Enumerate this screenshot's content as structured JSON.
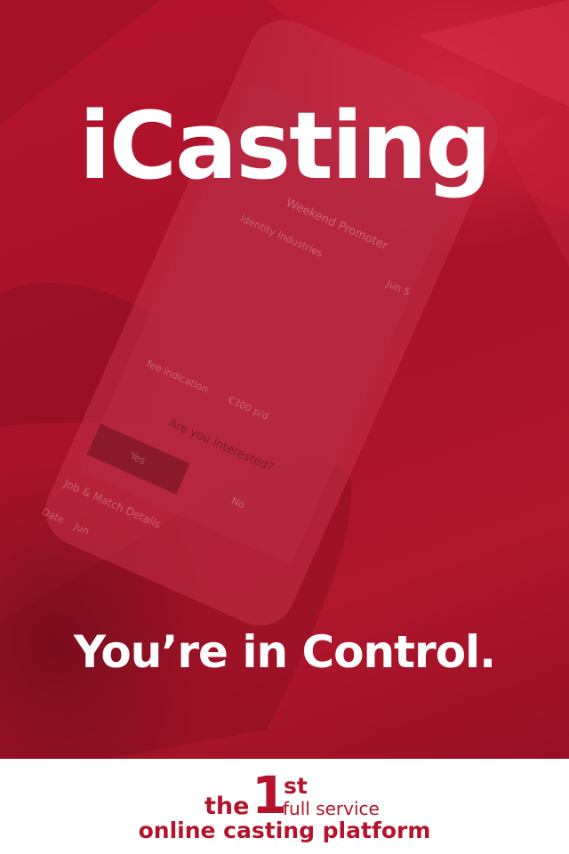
{
  "hero": {
    "logo": "iCasting",
    "tagline": "You’re in Control.",
    "phone_screen": {
      "title": "Weekend Promoter",
      "row_label": "Identity Industries",
      "row_value": "Jun 5",
      "fee_label": "fee indication",
      "fee_value": "€300 p/d",
      "question": "Are you interested?",
      "yes_label": "Yes",
      "no_label": "No",
      "section_label": "Job & Match Details",
      "date_label": "Date",
      "date_value": "Jun"
    }
  },
  "footer": {
    "the": "the",
    "ordinal_number": "1",
    "ordinal_suffix": "st",
    "full_service": "full service",
    "line2": "online casting platform"
  },
  "colors": {
    "brand_red": "#b3142c",
    "text_white": "#ffffff",
    "footer_bg": "#ffffff"
  }
}
